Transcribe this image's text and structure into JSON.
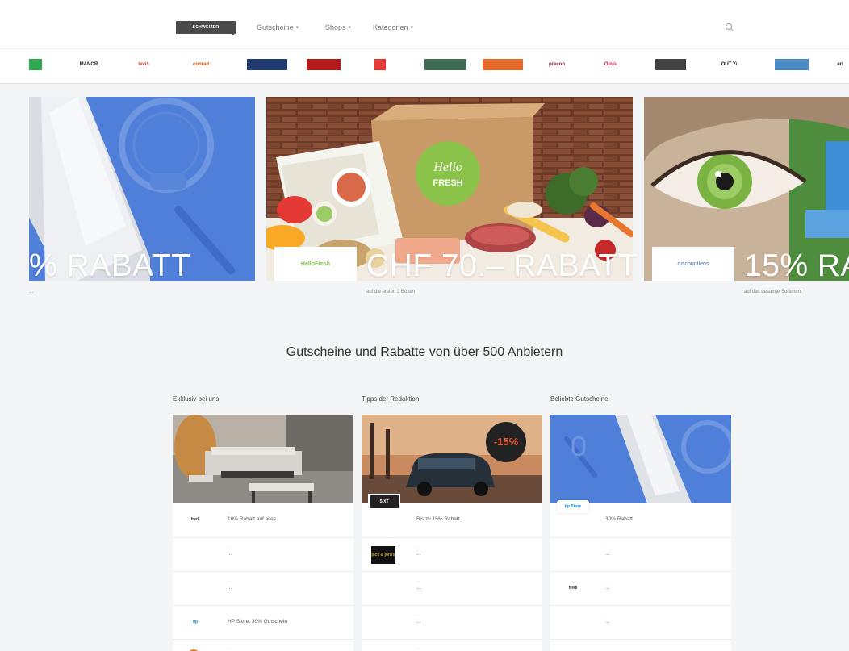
{
  "nav": {
    "logo_text": "SCHWEIZER",
    "items": [
      {
        "label": "Gutscheine"
      },
      {
        "label": "Shops"
      },
      {
        "label": "Kategorien"
      }
    ]
  },
  "brands": [
    {
      "label": "",
      "color": "#2fa84f"
    },
    {
      "label": "MANOR",
      "color": "#222222"
    },
    {
      "label": "levis",
      "color": "#c0392b"
    },
    {
      "label": "conrad",
      "color": "#d35400"
    },
    {
      "label": "",
      "color": "#1e3a6e"
    },
    {
      "label": "",
      "color": "#b71c1c"
    },
    {
      "label": "",
      "color": "#e53935"
    },
    {
      "label": "",
      "color": "#3f6b55"
    },
    {
      "label": "",
      "color": "#e66a2c"
    },
    {
      "label": "precon",
      "color": "#7b1f3a"
    },
    {
      "label": "Olivia",
      "color": "#c2185b"
    },
    {
      "label": "",
      "color": "#424242"
    },
    {
      "label": "ABOUT YOU",
      "color": "#111111"
    },
    {
      "label": "",
      "color": "#4a8ac7"
    },
    {
      "label": "eri",
      "color": "#222222"
    }
  ],
  "hero": {
    "slides": [
      {
        "title": "% RABATT",
        "subtitle": "...",
        "logo": ""
      },
      {
        "title": "CHF 70.– RABATT",
        "subtitle": "auf die ersten 3 Boxen",
        "logo": "HelloFresh"
      },
      {
        "title": "15% RA",
        "subtitle": "auf das gesamte Sortiment",
        "logo": "discountlens"
      }
    ],
    "box_text": "Hello FRESH"
  },
  "section_title": "Gutscheine und Rabatte von über 500 Anbietern",
  "columns": [
    {
      "title": "Exklusiv bei uns",
      "feature": {
        "logo": "fredi",
        "kicker": "...",
        "text": "10% Rabatt auf alles"
      },
      "rows": [
        {
          "logo": "",
          "kicker": "...",
          "text": "..."
        },
        {
          "logo": "",
          "kicker": "...",
          "text": "..."
        },
        {
          "logo": "hp",
          "kicker": "...",
          "text": "HP Store: 30% Gutschein"
        },
        {
          "logo": "",
          "kicker": "...",
          "text": "..."
        }
      ]
    },
    {
      "title": "Tipps der Redaktion",
      "feature": {
        "logo": "SIXT",
        "kicker": "...",
        "text": "Bis zu 15% Rabatt"
      },
      "rows": [
        {
          "logo": "jack & jones",
          "kicker": "...",
          "text": "..."
        },
        {
          "logo": "",
          "kicker": "...",
          "text": "..."
        },
        {
          "logo": "",
          "kicker": "...",
          "text": "..."
        },
        {
          "logo": "",
          "kicker": "...",
          "text": "..."
        }
      ],
      "badge": {
        "top": "",
        "value": "-15%",
        "bottom": ""
      }
    },
    {
      "title": "Beliebte Gutscheine",
      "feature": {
        "logo": "hp Store",
        "kicker": "...",
        "text": "30% Rabatt"
      },
      "rows": [
        {
          "logo": "",
          "kicker": "...",
          "text": "..."
        },
        {
          "logo": "fredi",
          "kicker": "...",
          "text": "..."
        },
        {
          "logo": "",
          "kicker": "...",
          "text": "..."
        },
        {
          "logo": "",
          "kicker": "...",
          "text": "..."
        }
      ]
    }
  ],
  "colors": {
    "hero_blue": "#4f7fd9",
    "accent_red": "#e53935"
  }
}
